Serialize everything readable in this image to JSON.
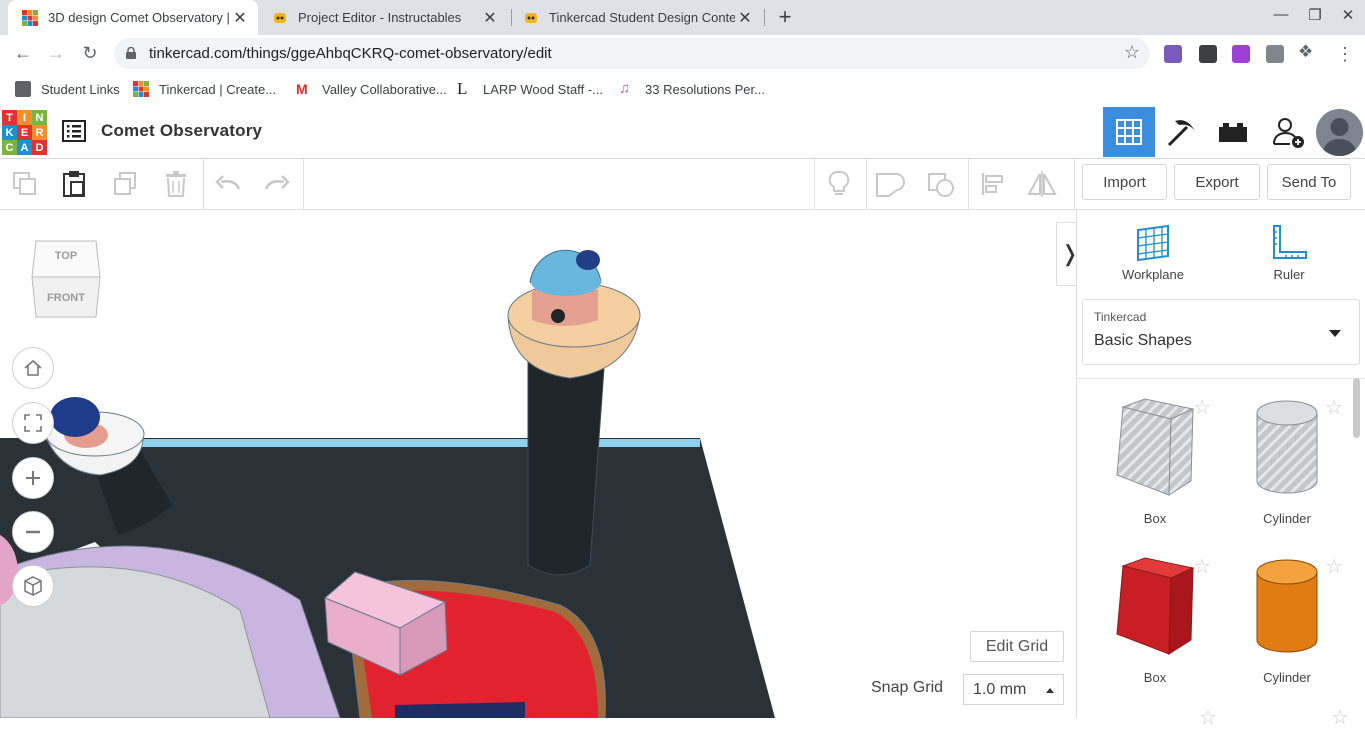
{
  "browser": {
    "tabs": [
      {
        "title": "3D design Comet Observatory | T",
        "active": true,
        "close": "✕"
      },
      {
        "title": "Project Editor - Instructables",
        "active": false,
        "close": "✕"
      },
      {
        "title": "Tinkercad Student Design Contest",
        "active": false,
        "close": "✕"
      }
    ],
    "new_tab": "+",
    "url": "tinkercad.com/things/ggeAhbqCKRQ-comet-observatory/edit",
    "bookmarks": [
      {
        "label": "Student Links",
        "icon": "folder-icon"
      },
      {
        "label": "Tinkercad | Create...",
        "icon": "tinkercad-icon"
      },
      {
        "label": "Valley Collaborative...",
        "icon": "gmail-icon"
      },
      {
        "label": "LARP Wood Staff -...",
        "icon": "l-icon"
      },
      {
        "label": "33 Resolutions Per...",
        "icon": "music-note-icon"
      }
    ]
  },
  "app": {
    "logo_letters": [
      "T",
      "I",
      "N",
      "K",
      "E",
      "R",
      "C",
      "A",
      "D"
    ],
    "project_title": "Comet Observatory",
    "toolbar": {
      "import_label": "Import",
      "export_label": "Export",
      "send_to_label": "Send To"
    },
    "view_cube": {
      "top": "TOP",
      "front": "FRONT"
    },
    "sidebar": {
      "workplane_label": "Workplane",
      "ruler_label": "Ruler",
      "library_source": "Tinkercad",
      "library_name": "Basic Shapes",
      "shapes": [
        {
          "label": "Box",
          "icon": "box-hole-icon"
        },
        {
          "label": "Cylinder",
          "icon": "cylinder-hole-icon"
        },
        {
          "label": "Box",
          "icon": "box-red-icon"
        },
        {
          "label": "Cylinder",
          "icon": "cylinder-orange-icon"
        }
      ]
    },
    "edit_grid_label": "Edit Grid",
    "snap_grid_label": "Snap Grid",
    "snap_grid_value": "1.0 mm",
    "collapse_glyph": "❭"
  },
  "colors": {
    "tinkercad_red": "#e2322d",
    "tinkercad_orange": "#f58f25",
    "tinkercad_green": "#7cb342",
    "tinkercad_blue": "#1f8fd0",
    "accent_blue": "#3c8ce0",
    "workplane_dark": "#2a3137",
    "grid_edge": "#8fd0ee"
  }
}
